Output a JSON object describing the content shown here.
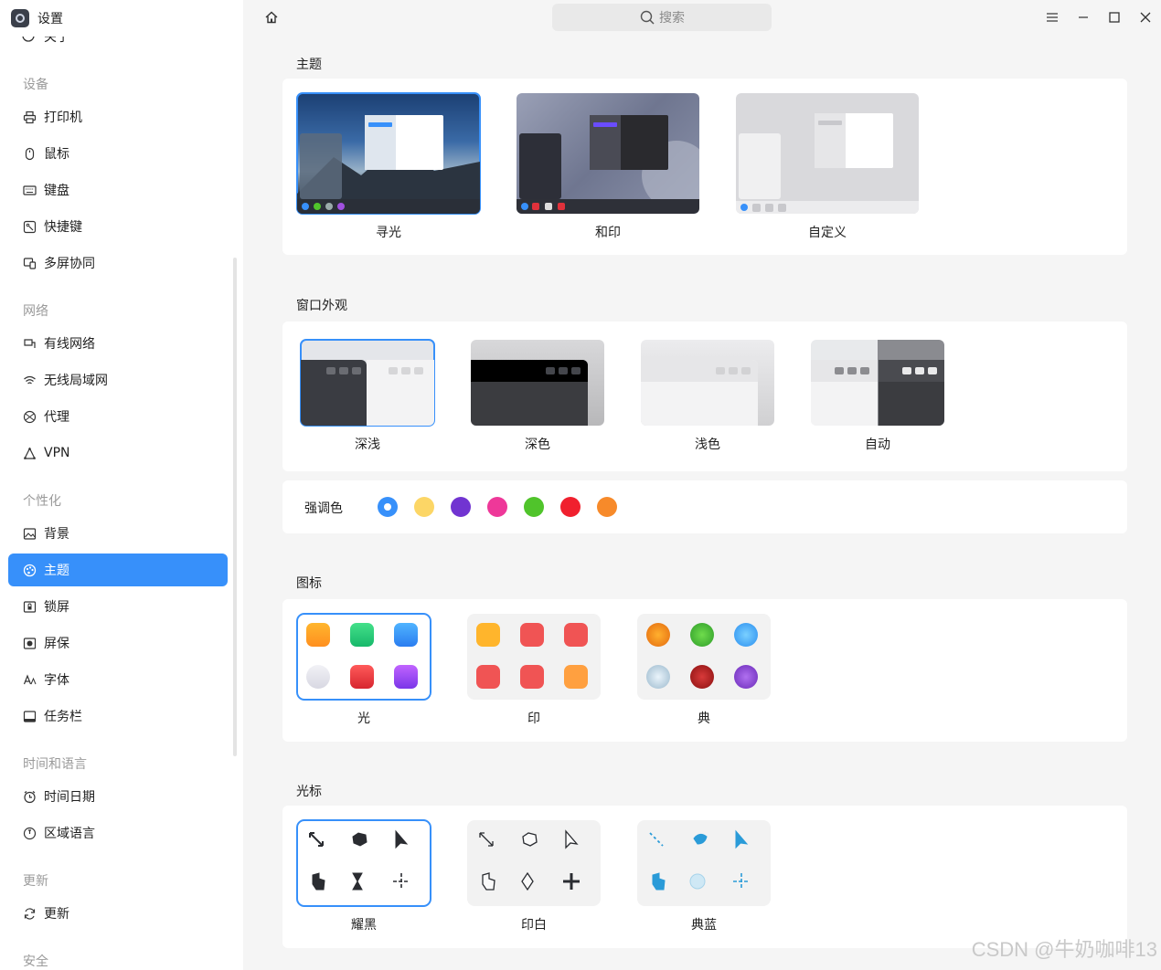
{
  "app": {
    "title": "设置"
  },
  "sidebar": {
    "partial_item": "关于",
    "sections": [
      {
        "title": "设备",
        "items": [
          {
            "label": "打印机",
            "icon": "printer-icon"
          },
          {
            "label": "鼠标",
            "icon": "mouse-icon"
          },
          {
            "label": "键盘",
            "icon": "keyboard-icon"
          },
          {
            "label": "快捷键",
            "icon": "shortcut-icon"
          },
          {
            "label": "多屏协同",
            "icon": "multiscreen-icon"
          }
        ]
      },
      {
        "title": "网络",
        "items": [
          {
            "label": "有线网络",
            "icon": "wired-network-icon"
          },
          {
            "label": "无线局域网",
            "icon": "wifi-icon"
          },
          {
            "label": "代理",
            "icon": "proxy-icon"
          },
          {
            "label": "VPN",
            "icon": "vpn-icon"
          }
        ]
      },
      {
        "title": "个性化",
        "items": [
          {
            "label": "背景",
            "icon": "background-icon"
          },
          {
            "label": "主题",
            "icon": "theme-icon",
            "active": true
          },
          {
            "label": "锁屏",
            "icon": "lockscreen-icon"
          },
          {
            "label": "屏保",
            "icon": "screensaver-icon"
          },
          {
            "label": "字体",
            "icon": "font-icon"
          },
          {
            "label": "任务栏",
            "icon": "taskbar-icon"
          }
        ]
      },
      {
        "title": "时间和语言",
        "items": [
          {
            "label": "时间日期",
            "icon": "clock-icon"
          },
          {
            "label": "区域语言",
            "icon": "region-icon"
          }
        ]
      },
      {
        "title": "更新",
        "items": [
          {
            "label": "更新",
            "icon": "update-icon"
          }
        ]
      },
      {
        "title": "安全",
        "items": []
      }
    ]
  },
  "topbar": {
    "search_placeholder": "搜索"
  },
  "main": {
    "theme": {
      "title": "主题",
      "options": [
        "寻光",
        "和印",
        "自定义"
      ],
      "selected": "寻光"
    },
    "window": {
      "title": "窗口外观",
      "options": [
        "深浅",
        "深色",
        "浅色",
        "自动"
      ],
      "selected": "深浅"
    },
    "accent": {
      "label": "强调色",
      "colors": [
        "#3790fa",
        "#fcd666",
        "#7134d1",
        "#ee3899",
        "#50c42b",
        "#f0202e",
        "#f78a2a"
      ],
      "selected": "#3790fa"
    },
    "icons": {
      "title": "图标",
      "options": [
        "光",
        "印",
        "典"
      ],
      "selected": "光"
    },
    "cursor": {
      "title": "光标",
      "options": [
        "耀黑",
        "印白",
        "典蓝"
      ],
      "selected": "耀黑"
    }
  },
  "watermark": "CSDN @牛奶咖啡13"
}
